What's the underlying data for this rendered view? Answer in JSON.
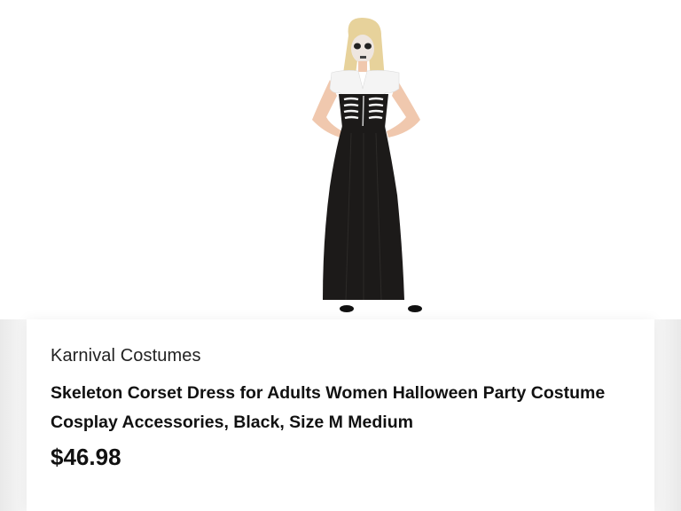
{
  "product": {
    "brand": "Karnival Costumes",
    "title": "Skeleton Corset Dress for Adults Women Halloween Party Costume Cosplay Accessories, Black, Size M Medium",
    "price": "$46.98"
  },
  "colors": {
    "dress": "#1c1a19",
    "blouse": "#f4f4f4",
    "hair": "#e7d29b",
    "skin": "#f0c8ae"
  }
}
